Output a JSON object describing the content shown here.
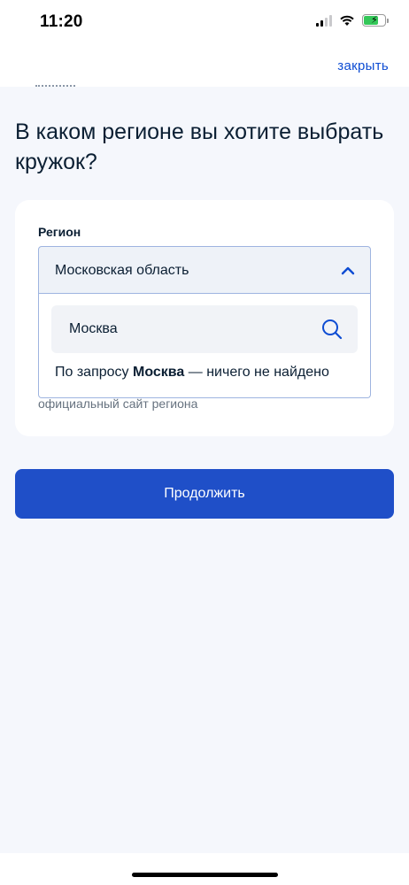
{
  "status_bar": {
    "time": "11:20",
    "icons": [
      "cellular-signal-icon",
      "wifi-icon",
      "battery-charging-icon"
    ]
  },
  "header": {
    "close_label": "закрыть"
  },
  "page": {
    "title": "В каком регионе вы хотите выбрать кружок?"
  },
  "region_field": {
    "label": "Регион",
    "selected_value": "Московская область",
    "search_value": "Москва",
    "no_results_prefix": "По запросу ",
    "no_results_query": "Москва",
    "no_results_suffix": " — ничего не найдено",
    "hint": "официальный сайт региона"
  },
  "actions": {
    "continue_label": "Продолжить"
  },
  "colors": {
    "accent": "#0d4cd3",
    "button": "#1f4fc8",
    "background": "#f5f7fc"
  }
}
